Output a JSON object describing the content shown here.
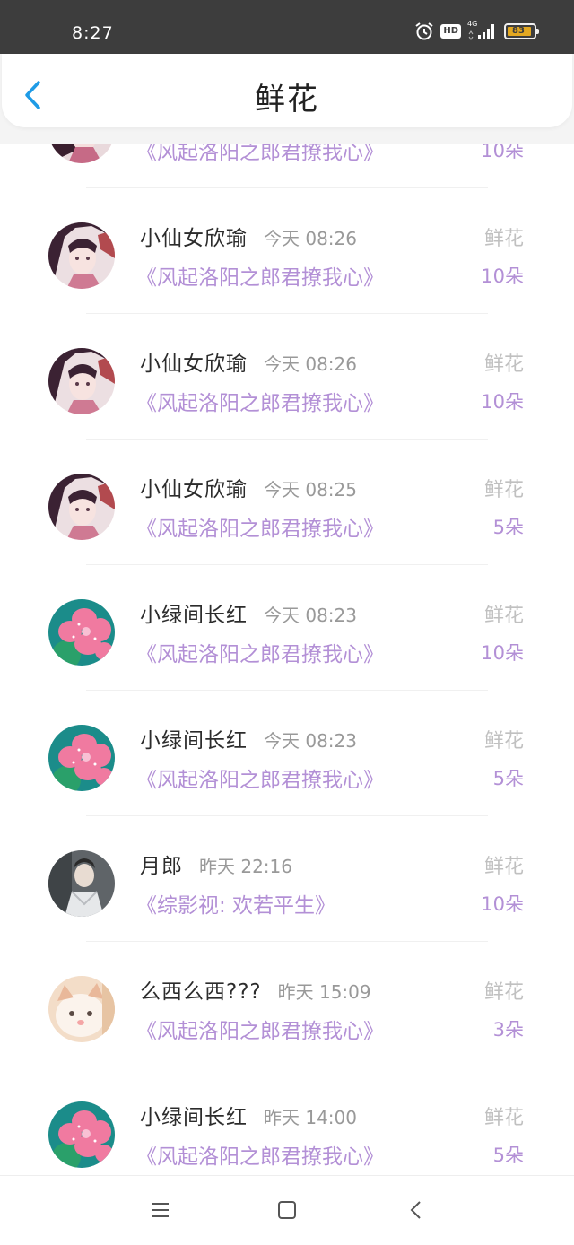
{
  "status_bar": {
    "time": "8:27",
    "hd": "HD",
    "network": "4G",
    "battery": "83"
  },
  "header": {
    "title": "鲜花"
  },
  "rows": [
    {
      "name": "",
      "time": "",
      "book": "《风起洛阳之郎君撩我心》",
      "gift": "",
      "count": "10朵",
      "avatar": "girl-avatar"
    },
    {
      "name": "小仙女欣瑜",
      "time": "今天 08:26",
      "book": "《风起洛阳之郎君撩我心》",
      "gift": "鲜花",
      "count": "10朵",
      "avatar": "girl-avatar"
    },
    {
      "name": "小仙女欣瑜",
      "time": "今天 08:26",
      "book": "《风起洛阳之郎君撩我心》",
      "gift": "鲜花",
      "count": "10朵",
      "avatar": "girl-avatar"
    },
    {
      "name": "小仙女欣瑜",
      "time": "今天 08:25",
      "book": "《风起洛阳之郎君撩我心》",
      "gift": "鲜花",
      "count": "5朵",
      "avatar": "girl-avatar"
    },
    {
      "name": "小绿间长红",
      "time": "今天 08:23",
      "book": "《风起洛阳之郎君撩我心》",
      "gift": "鲜花",
      "count": "10朵",
      "avatar": "flower-avatar"
    },
    {
      "name": "小绿间长红",
      "time": "今天 08:23",
      "book": "《风起洛阳之郎君撩我心》",
      "gift": "鲜花",
      "count": "5朵",
      "avatar": "flower-avatar"
    },
    {
      "name": "月郎",
      "time": "昨天 22:16",
      "book": "《综影视: 欢若平生》",
      "gift": "鲜花",
      "count": "10朵",
      "avatar": "man-avatar"
    },
    {
      "name": "么西么西???",
      "time": "昨天 15:09",
      "book": "《风起洛阳之郎君撩我心》",
      "gift": "鲜花",
      "count": "3朵",
      "avatar": "cat-avatar"
    },
    {
      "name": "小绿间长红",
      "time": "昨天 14:00",
      "book": "《风起洛阳之郎君撩我心》",
      "gift": "鲜花",
      "count": "5朵",
      "avatar": "flower-avatar"
    }
  ],
  "colors": {
    "accent": "#1e9be6",
    "book_purple": "#b390d6",
    "status_bg": "#3d3d3d"
  }
}
